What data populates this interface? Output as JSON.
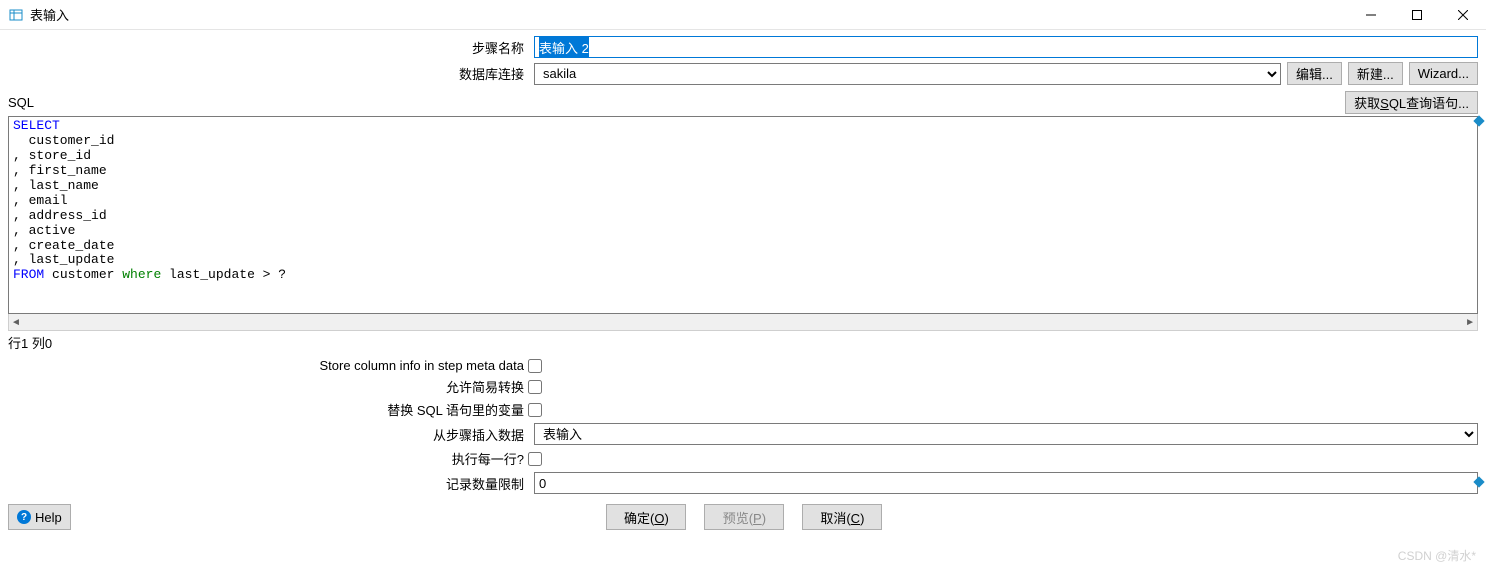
{
  "window": {
    "title": "表输入",
    "icon": "table-input-icon"
  },
  "form": {
    "step_name_label": "步骤名称",
    "step_name_value": "表输入 2",
    "db_conn_label": "数据库连接",
    "db_conn_value": "sakila",
    "btn_edit": "编辑...",
    "btn_new": "新建...",
    "btn_wizard": "Wizard..."
  },
  "sql": {
    "header_label": "SQL",
    "btn_get_query_prefix": "获取",
    "btn_get_query_underline": "S",
    "btn_get_query_suffix": "QL查询语句...",
    "kw_select": "SELECT",
    "lines_indented": "  customer_id\n, store_id\n, first_name\n, last_name\n, email\n, address_id\n, active\n, create_date\n, last_update",
    "kw_from": "FROM",
    "from_rest": " customer ",
    "kw_where": "where",
    "where_rest": " last_update > ?",
    "status": "行1 列0"
  },
  "options": {
    "store_col_info": "Store column info in step meta data",
    "allow_lazy": "允许简易转换",
    "replace_vars": "替换 SQL 语句里的变量",
    "from_step_label": "从步骤插入数据",
    "from_step_value": "表输入",
    "exec_each_row": "执行每一行?",
    "limit_label": "记录数量限制",
    "limit_value": "0"
  },
  "footer": {
    "help": "Help",
    "ok_prefix": "确定(",
    "ok_u": "O",
    "ok_suffix": ")",
    "preview_prefix": "预览(",
    "preview_u": "P",
    "preview_suffix": ")",
    "cancel_prefix": "取消(",
    "cancel_u": "C",
    "cancel_suffix": ")"
  },
  "watermark": "CSDN @清水*"
}
